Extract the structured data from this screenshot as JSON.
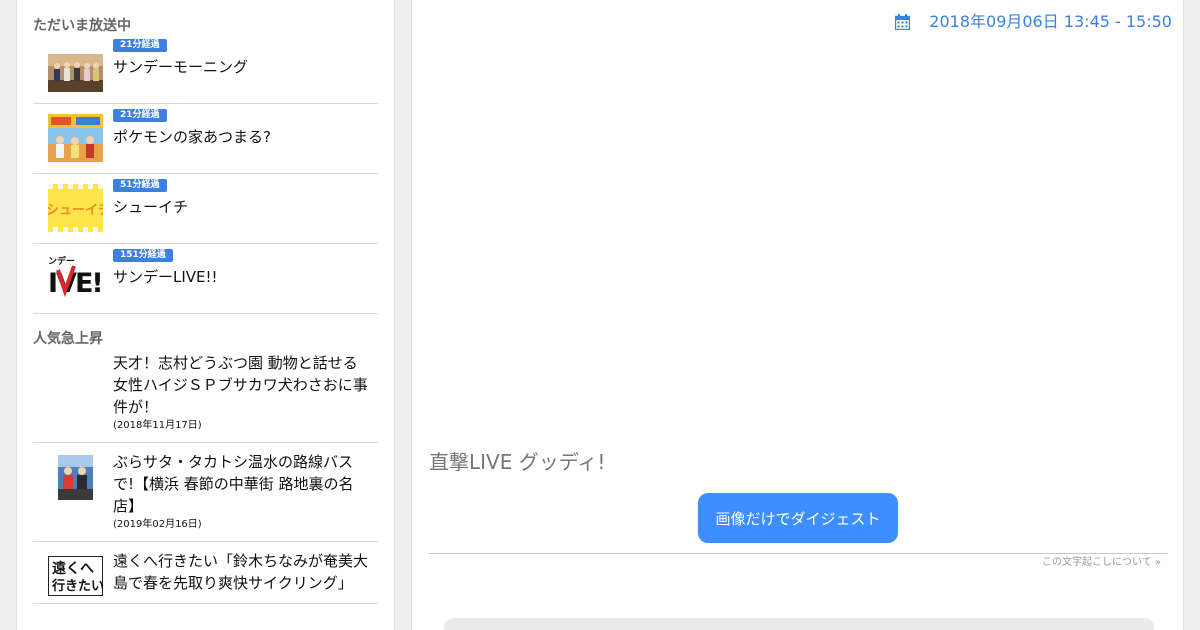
{
  "sidebar": {
    "onair_title": "ただいま放送中",
    "onair_items": [
      {
        "badge": "21分経過",
        "title": "サンデーモーニング"
      },
      {
        "badge": "21分経過",
        "title": "ポケモンの家あつまる?"
      },
      {
        "badge": "51分経過",
        "title": "シューイチ",
        "thumb_text": "シューイチ"
      },
      {
        "badge": "151分経過",
        "title": "サンデーLIVE!!",
        "thumb_text_top": "ンデー",
        "thumb_text_main": "IVE!"
      }
    ],
    "rising_title": "人気急上昇",
    "rising_items": [
      {
        "title": "天才！志村どうぶつ園 動物と話せる女性ハイジＳＰブサカワ犬わさおに事件が！",
        "date": "(2018年11月17日)"
      },
      {
        "title": "ぶらサタ・タカトシ温水の路線バスで!【横浜 春節の中華街 路地裏の名店】",
        "date": "(2019年02月16日)"
      },
      {
        "title": "遠くへ行きたい「鈴木ちなみが奄美大島で春を先取り爽快サイクリング」",
        "date": "",
        "thumb_text_1": "遠くへ",
        "thumb_text_2": "行きたい"
      }
    ]
  },
  "main": {
    "datetime": "2018年09月06日 13:45 - 15:50",
    "program_title": "直撃LIVE グッディ!",
    "digest_button": "画像だけでダイジェスト",
    "about_link": "この文字起こしについて »"
  },
  "colors": {
    "accent": "#3d80e0",
    "button": "#3d8fff",
    "section_title": "#666666"
  },
  "icons": {
    "datetime": "calendar-icon"
  }
}
